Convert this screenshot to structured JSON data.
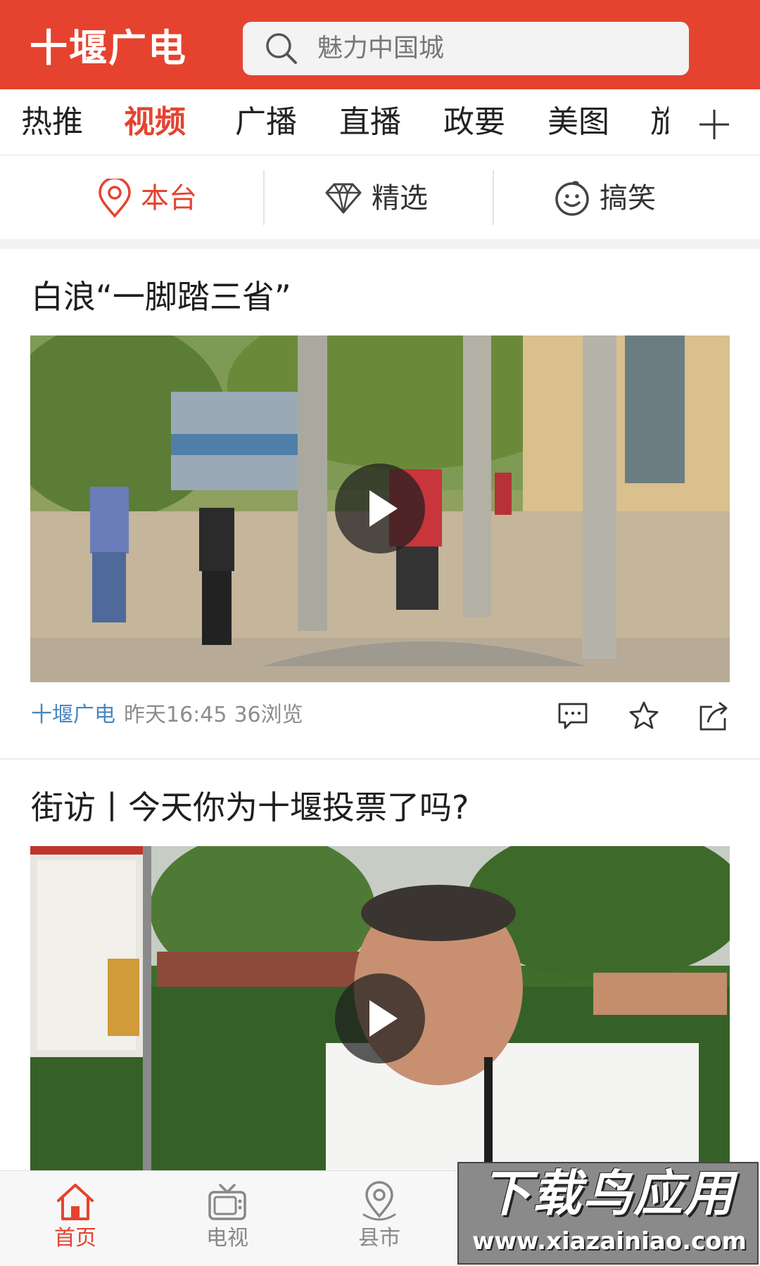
{
  "header": {
    "brand": "十堰广电",
    "search_placeholder": "魅力中国城"
  },
  "tabs": [
    "热推",
    "视频",
    "广播",
    "直播",
    "政要",
    "美图",
    "旅"
  ],
  "active_tab": "视频",
  "filters": [
    {
      "label": "本台",
      "icon": "location-pin-icon"
    },
    {
      "label": "精选",
      "icon": "diamond-icon"
    },
    {
      "label": "搞笑",
      "icon": "smiley-icon"
    }
  ],
  "articles": [
    {
      "title": "白浪“一脚踏三省”",
      "source": "十堰广电",
      "time": "昨天16:45",
      "views": "36浏览"
    },
    {
      "title": "街访丨今天你为十堰投票了吗?"
    }
  ],
  "bottom_nav": [
    {
      "label": "首页",
      "icon": "home-icon"
    },
    {
      "label": "电视",
      "icon": "tv-icon"
    },
    {
      "label": "县市",
      "icon": "location-pin-icon"
    }
  ],
  "watermark": {
    "line1": "下载鸟应用",
    "line2": "www.xiazainiao.com"
  },
  "colors": {
    "brand_red": "#e5432f",
    "source_blue": "#4a88bd"
  }
}
